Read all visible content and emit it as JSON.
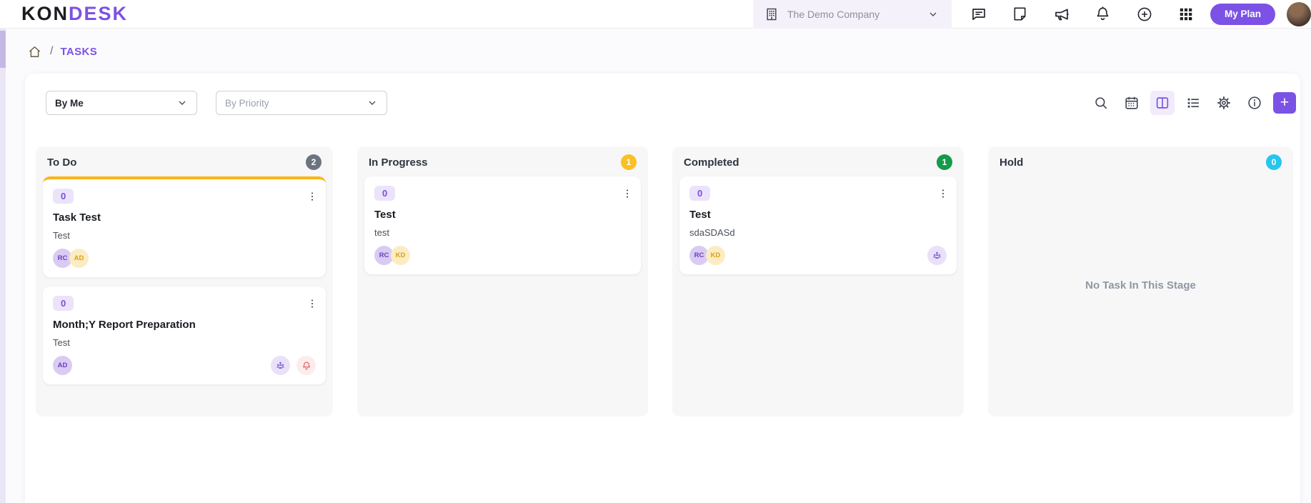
{
  "header": {
    "logo_kon": "KON",
    "logo_desk": "DESK",
    "company": "The Demo Company",
    "my_plan": "My Plan"
  },
  "breadcrumb": {
    "separator": "/",
    "current": "TASKS"
  },
  "filters": {
    "assignee_value": "By Me",
    "priority_placeholder": "By Priority"
  },
  "colors": {
    "accent_purple": "#7b52e5",
    "card_accent_yellow": "#fcb514",
    "todo_badge": "#6c7480",
    "inprogress_badge": "#fcbf24",
    "completed_badge": "#149a48",
    "hold_badge": "#25c6ef"
  },
  "board": {
    "columns": [
      {
        "name": "To Do",
        "count": "2",
        "cards": [
          {
            "chip": "0",
            "title": "Task Test",
            "description": "Test",
            "assignees": [
              {
                "initials": "RC"
              },
              {
                "initials": "AD"
              }
            ]
          },
          {
            "chip": "0",
            "title": "Month;Y Report Preparation",
            "description": "Test",
            "assignees": [
              {
                "initials": "AD"
              }
            ]
          }
        ]
      },
      {
        "name": "In Progress",
        "count": "1",
        "cards": [
          {
            "chip": "0",
            "title": "Test",
            "description": "test",
            "assignees": [
              {
                "initials": "RC"
              },
              {
                "initials": "KD"
              }
            ]
          }
        ]
      },
      {
        "name": "Completed",
        "count": "1",
        "cards": [
          {
            "chip": "0",
            "title": "Test",
            "description": "sdaSDASd",
            "assignees": [
              {
                "initials": "RC"
              },
              {
                "initials": "KD"
              }
            ]
          }
        ]
      },
      {
        "name": "Hold",
        "count": "0",
        "empty_text": "No Task In This Stage"
      }
    ]
  }
}
